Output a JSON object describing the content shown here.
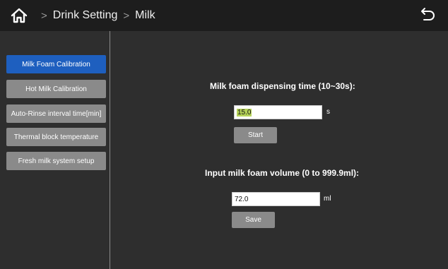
{
  "header": {
    "breadcrumbs": [
      "Drink Setting",
      "Milk"
    ],
    "separator": ">"
  },
  "sidebar": {
    "items": [
      {
        "label": "Milk Foam Calibration",
        "active": true
      },
      {
        "label": "Hot Milk Calibration",
        "active": false
      },
      {
        "label": "Auto-Rinse interval time[min]",
        "active": false
      },
      {
        "label": "Thermal block temperature",
        "active": false
      },
      {
        "label": "Fresh milk system setup",
        "active": false
      }
    ]
  },
  "main": {
    "dispense": {
      "label": "Milk foam dispensing time (10~30s):",
      "value": "15.0",
      "unit": "s",
      "button_label": "Start"
    },
    "volume": {
      "label": "Input  milk foam volume (0 to 999.9ml):",
      "value": "72.0",
      "unit": "ml",
      "button_label": "Save"
    }
  },
  "colors": {
    "active_tab": "#1e5fbf",
    "button": "#8a8a8a",
    "header": "#1d1d1d",
    "background": "#2e2e2e",
    "text_highlight": "#b6d35a"
  },
  "icons": {
    "home": "home-icon",
    "back": "back-arrow-icon"
  }
}
